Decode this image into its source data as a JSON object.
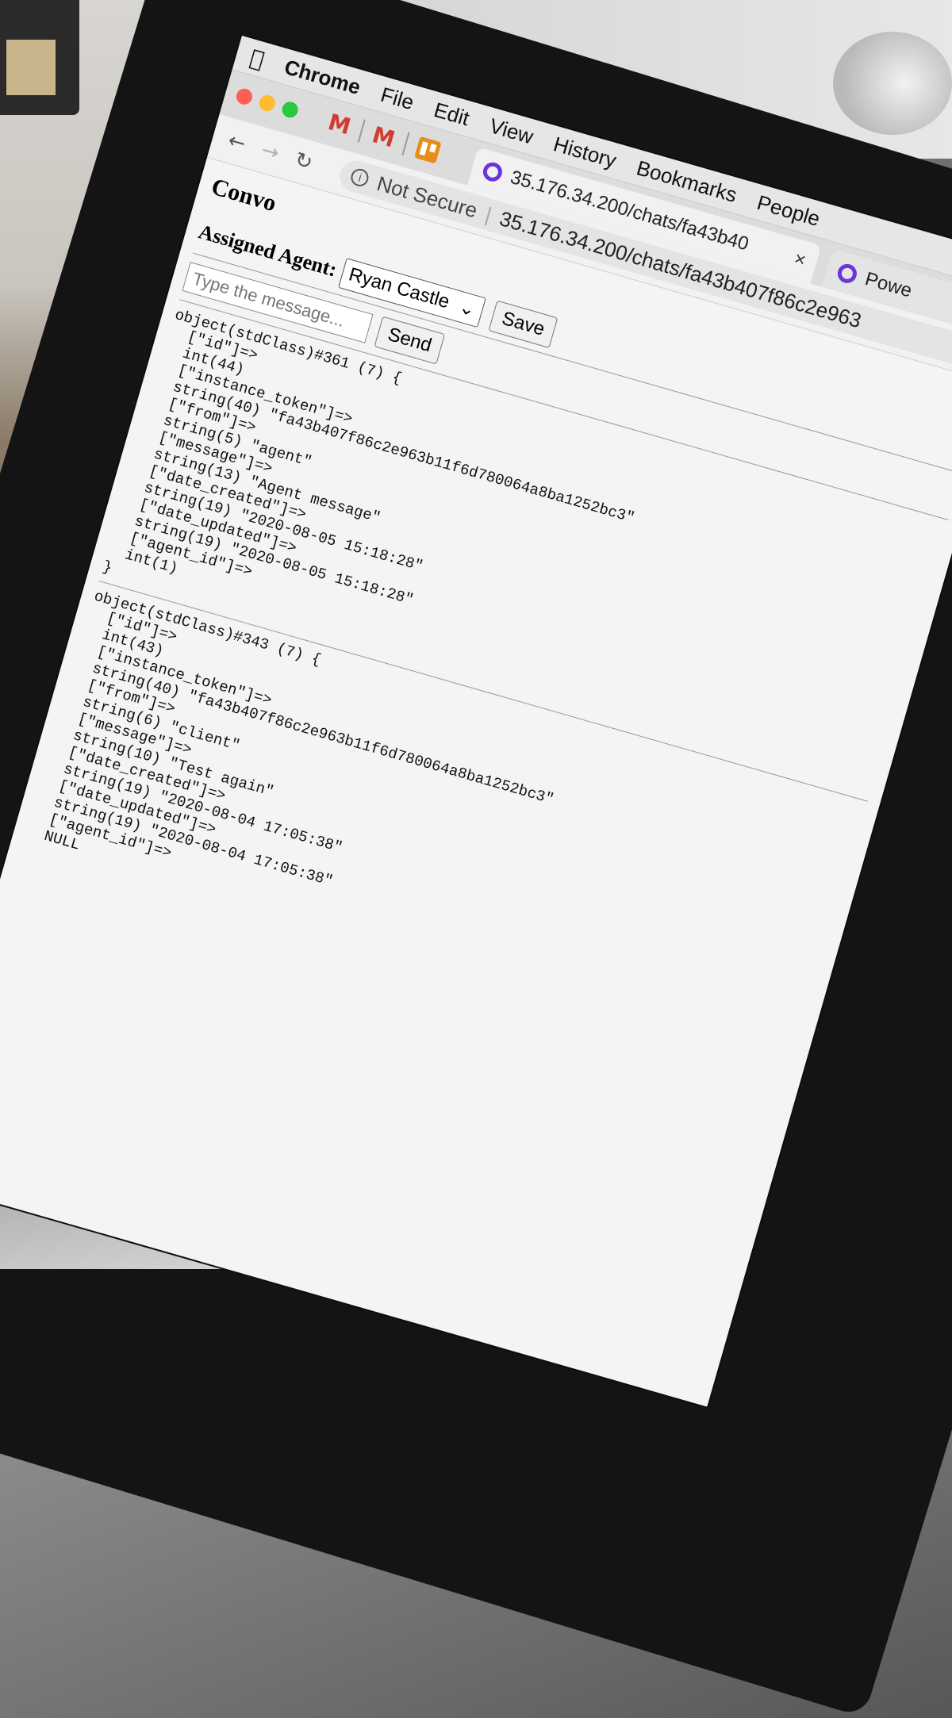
{
  "menubar": {
    "app": "Chrome",
    "items": [
      "File",
      "Edit",
      "View",
      "History",
      "Bookmarks",
      "People"
    ]
  },
  "tabs": {
    "pinned": [
      "M",
      "M"
    ],
    "active": {
      "title": "35.176.34.200/chats/fa43b40",
      "close": "×"
    },
    "inactive": {
      "title": "Powe"
    }
  },
  "toolbar": {
    "back": "←",
    "forward": "→",
    "reload": "C",
    "security": "Not Secure",
    "url": "35.176.34.200/chats/fa43b407f86c2e963"
  },
  "page": {
    "title": "Convo",
    "agent_label": "Assigned Agent:",
    "agent_selected": "Ryan Castle",
    "save_label": "Save",
    "message_placeholder": "Type the message...",
    "send_label": "Send",
    "dumps": [
      "object(stdClass)#361 (7) {\n  [\"id\"]=>\n  int(44)\n  [\"instance_token\"]=>\n  string(40) \"fa43b407f86c2e963b11f6d780064a8ba1252bc3\"\n  [\"from\"]=>\n  string(5) \"agent\"\n  [\"message\"]=>\n  string(13) \"Agent message\"\n  [\"date_created\"]=>\n  string(19) \"2020-08-05 15:18:28\"\n  [\"date_updated\"]=>\n  string(19) \"2020-08-05 15:18:28\"\n  [\"agent_id\"]=>\n  int(1)\n}",
      "object(stdClass)#343 (7) {\n  [\"id\"]=>\n  int(43)\n  [\"instance_token\"]=>\n  string(40) \"fa43b407f86c2e963b11f6d780064a8ba1252bc3\"\n  [\"from\"]=>\n  string(6) \"client\"\n  [\"message\"]=>\n  string(10) \"Test again\"\n  [\"date_created\"]=>\n  string(19) \"2020-08-04 17:05:38\"\n  [\"date_updated\"]=>\n  string(19) \"2020-08-04 17:05:38\"\n  [\"agent_id\"]=>\n  NULL"
    ]
  },
  "colors": {
    "close_light": "#ff5f57",
    "minimize_light": "#febc2e",
    "zoom_light": "#28c840",
    "gmail": "#d23b2f",
    "trello": "#e88d1c",
    "favicon": "#6a36d9"
  }
}
